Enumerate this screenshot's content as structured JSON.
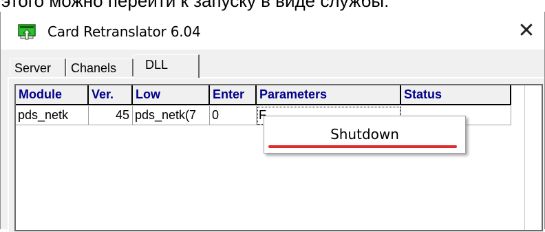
{
  "page_caption": "этого можно перейти к запуску в виде службы:",
  "window": {
    "title": "Card Retranslator 6.04",
    "close_glyph": "✕"
  },
  "tabs": [
    {
      "label": "Server",
      "active": false
    },
    {
      "label": "Chanels",
      "active": false
    },
    {
      "label": "DLL",
      "active": true
    }
  ],
  "grid": {
    "columns": [
      "Module",
      "Ver.",
      "Low",
      "Enter",
      "Parameters",
      "Status"
    ],
    "rows": [
      {
        "module": "pds_netk",
        "ver": "45",
        "low": "pds_netk(7",
        "enter": "0",
        "parameters": "F",
        "status": ""
      }
    ]
  },
  "context_menu": {
    "items": [
      {
        "label": "Shutdown"
      }
    ]
  },
  "colors": {
    "header_text": "#00008b",
    "highlight_underline": "#e02b2b",
    "icon_green": "#2fbf2f"
  },
  "icons": {
    "app": "terminal-arrow-icon",
    "close": "close-icon"
  }
}
